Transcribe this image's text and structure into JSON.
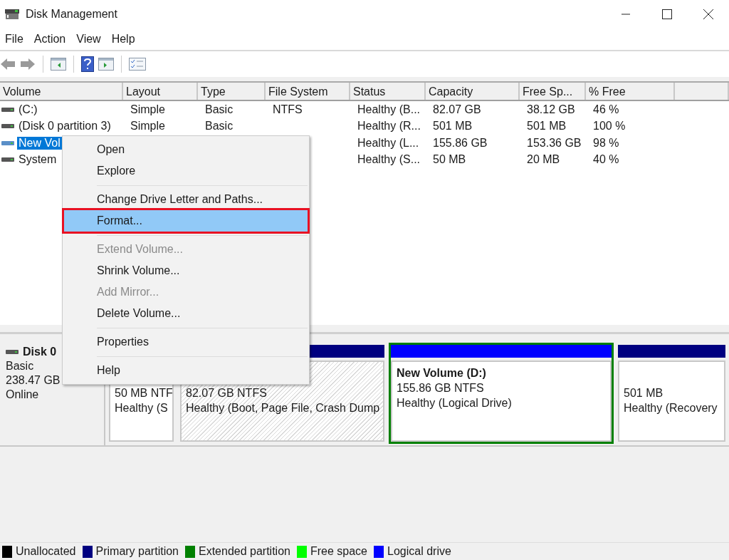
{
  "window": {
    "title": "Disk Management"
  },
  "menu_bar": [
    "File",
    "Action",
    "View",
    "Help"
  ],
  "volume_table": {
    "columns": [
      "Volume",
      "Layout",
      "Type",
      "File System",
      "Status",
      "Capacity",
      "Free Sp...",
      "% Free"
    ],
    "rows": [
      {
        "volume": "(C:)",
        "layout": "Simple",
        "type": "Basic",
        "file_system": "NTFS",
        "status": "Healthy (B...",
        "capacity": "82.07 GB",
        "free_space": "38.12 GB",
        "percent_free": "46 %",
        "selected": false
      },
      {
        "volume": "(Disk 0 partition 3)",
        "layout": "Simple",
        "type": "Basic",
        "status": "Healthy (R...",
        "capacity": "501 MB",
        "free_space": "501 MB",
        "percent_free": "100 %",
        "selected": false
      },
      {
        "volume": "New Vol",
        "status": "Healthy (L...",
        "capacity": "155.86 GB",
        "free_space": "153.36 GB",
        "percent_free": "98 %",
        "selected": true
      },
      {
        "volume": "System",
        "status": "Healthy (S...",
        "capacity": "50 MB",
        "free_space": "20 MB",
        "percent_free": "40 %",
        "selected": false
      }
    ]
  },
  "disk": {
    "name": "Disk 0",
    "type": "Basic",
    "size": "238.47 GB",
    "state": "Online",
    "partitions": [
      {
        "size": "50 MB NTF",
        "status": "Healthy (S",
        "hatched": false,
        "selected": false
      },
      {
        "color": "#000080",
        "size": "82.07 GB NTFS",
        "status": "Healthy (Boot, Page File, Crash Dump",
        "hatched": true,
        "selected": false
      },
      {
        "color": "#0000ff",
        "label": "New Volume  (D:)",
        "size": "155.86 GB NTFS",
        "status": "Healthy (Logical Drive)",
        "hatched": false,
        "selected": true
      },
      {
        "color": "#000080",
        "size": "501 MB",
        "status": "Healthy (Recovery",
        "hatched": false,
        "selected": false
      }
    ]
  },
  "context_menu": [
    {
      "kind": "item",
      "label": "Open",
      "disabled": false,
      "selected": false,
      "outlined": false
    },
    {
      "kind": "item",
      "label": "Explore",
      "disabled": false,
      "selected": false,
      "outlined": false
    },
    {
      "kind": "separator"
    },
    {
      "kind": "item",
      "label": "Change Drive Letter and Paths...",
      "disabled": false,
      "selected": false,
      "outlined": false
    },
    {
      "kind": "item",
      "label": "Format...",
      "disabled": false,
      "selected": true,
      "outlined": true
    },
    {
      "kind": "separator"
    },
    {
      "kind": "item",
      "label": "Extend Volume...",
      "disabled": true,
      "selected": false,
      "outlined": false
    },
    {
      "kind": "item",
      "label": "Shrink Volume...",
      "disabled": false,
      "selected": false,
      "outlined": false
    },
    {
      "kind": "item",
      "label": "Add Mirror...",
      "disabled": true,
      "selected": false,
      "outlined": false
    },
    {
      "kind": "item",
      "label": "Delete Volume...",
      "disabled": false,
      "selected": false,
      "outlined": false
    },
    {
      "kind": "separator"
    },
    {
      "kind": "item",
      "label": "Properties",
      "disabled": false,
      "selected": false,
      "outlined": false
    },
    {
      "kind": "separator"
    },
    {
      "kind": "item",
      "label": "Help",
      "disabled": false,
      "selected": false,
      "outlined": false
    }
  ],
  "legend": [
    {
      "label": "Unallocated",
      "color": "#000000"
    },
    {
      "label": "Primary partition",
      "color": "#000080"
    },
    {
      "label": "Extended partition",
      "color": "#008000"
    },
    {
      "label": "Free space",
      "color": "#00ff00"
    },
    {
      "label": "Logical drive",
      "color": "#0000ff"
    }
  ]
}
